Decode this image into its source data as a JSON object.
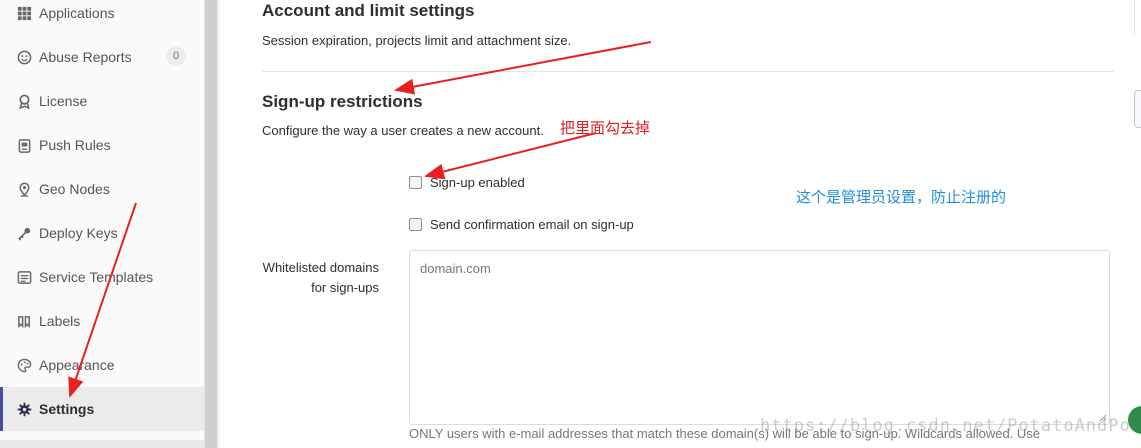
{
  "sidebar": {
    "items": [
      {
        "label": "Applications",
        "icon": "grid-icon"
      },
      {
        "label": "Abuse Reports",
        "icon": "smiley-icon",
        "badge": "0"
      },
      {
        "label": "License",
        "icon": "award-icon"
      },
      {
        "label": "Push Rules",
        "icon": "clipboard-icon"
      },
      {
        "label": "Geo Nodes",
        "icon": "location-icon"
      },
      {
        "label": "Deploy Keys",
        "icon": "key-icon"
      },
      {
        "label": "Service Templates",
        "icon": "template-icon"
      },
      {
        "label": "Labels",
        "icon": "labels-icon"
      },
      {
        "label": "Appearance",
        "icon": "palette-icon"
      },
      {
        "label": "Settings",
        "icon": "gear-icon",
        "active": true
      }
    ],
    "active_color": "#4b4ba3"
  },
  "account_section": {
    "title": "Account and limit settings",
    "description": "Session expiration, projects limit and attachment size."
  },
  "signup_section": {
    "title": "Sign-up restrictions",
    "description": "Configure the way a user creates a new account.",
    "signup_enabled_label": "Sign-up enabled",
    "confirmation_email_label": "Send confirmation email on sign-up",
    "whitelist_label": "Whitelisted domains for sign-ups",
    "whitelist_placeholder": "domain.com",
    "whitelist_help": "ONLY users with e-mail addresses that match these domain(s) will be able to sign-up. Wildcards allowed. Use"
  },
  "annotations": {
    "red_note": "把里面勾去掉",
    "blue_note": "这个是管理员设置，防止注册的",
    "red_color": "#e02020",
    "blue_color": "#1f8ee0"
  },
  "watermark": "https://blog.csdn.net/PotatoAndPotato"
}
